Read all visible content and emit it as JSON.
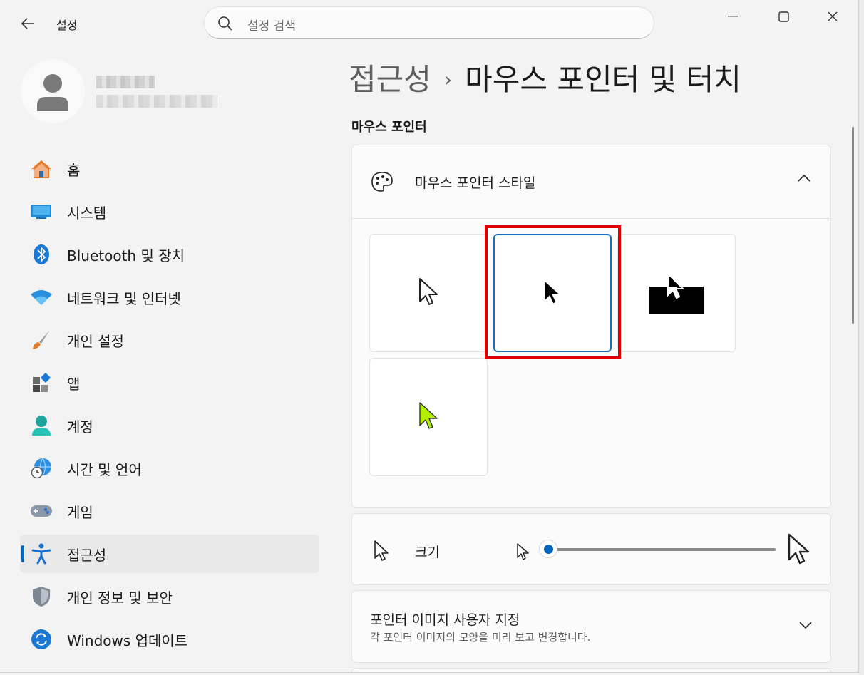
{
  "app": {
    "title": "설정"
  },
  "search": {
    "placeholder": "설정 검색"
  },
  "nav": {
    "items": [
      {
        "label": "홈",
        "icon": "home-icon"
      },
      {
        "label": "시스템",
        "icon": "system-icon"
      },
      {
        "label": "Bluetooth 및 장치",
        "icon": "bluetooth-icon"
      },
      {
        "label": "네트워크 및 인터넷",
        "icon": "wifi-icon"
      },
      {
        "label": "개인 설정",
        "icon": "brush-icon"
      },
      {
        "label": "앱",
        "icon": "apps-icon"
      },
      {
        "label": "계정",
        "icon": "account-icon"
      },
      {
        "label": "시간 및 언어",
        "icon": "globe-clock-icon"
      },
      {
        "label": "게임",
        "icon": "gamepad-icon"
      },
      {
        "label": "접근성",
        "icon": "accessibility-icon",
        "active": true
      },
      {
        "label": "개인 정보 및 보안",
        "icon": "shield-icon"
      },
      {
        "label": "Windows 업데이트",
        "icon": "update-icon"
      }
    ]
  },
  "breadcrumb": {
    "parent": "접근성",
    "separator": "›",
    "current": "마우스 포인터 및 터치"
  },
  "section": {
    "title": "마우스 포인터"
  },
  "pointer_style": {
    "title": "마우스 포인터 스타일",
    "options": [
      "white-pointer",
      "black-pointer",
      "inverted-pointer",
      "custom-lime-pointer"
    ],
    "selected": "black-pointer"
  },
  "size": {
    "label": "크기",
    "value": 1
  },
  "custom": {
    "title": "포인터 이미지 사용자 지정",
    "description": "각 포인터 이미지의 모양을 미리 보고 변경합니다."
  },
  "colors": {
    "accent": "#0067c0",
    "highlight": "#e00000",
    "lime": "#b4ee00"
  }
}
